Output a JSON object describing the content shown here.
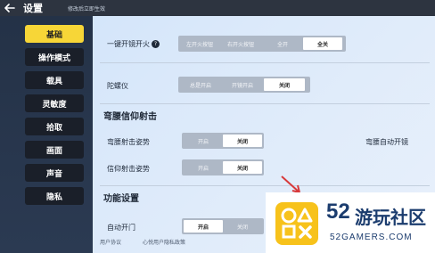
{
  "header": {
    "title": "设置",
    "hint": "修改后立即生效"
  },
  "sidebar": {
    "items": [
      {
        "label": "基础",
        "active": true
      },
      {
        "label": "操作模式"
      },
      {
        "label": "载具"
      },
      {
        "label": "灵敏度"
      },
      {
        "label": "拾取"
      },
      {
        "label": "画面"
      },
      {
        "label": "声音"
      },
      {
        "label": "隐私"
      }
    ]
  },
  "settings": {
    "one_key_fire": {
      "label": "一键开镜开火",
      "options": [
        "左开火按钮",
        "右开火按钮",
        "全开",
        "全关"
      ],
      "selected": "全关"
    },
    "gyroscope": {
      "label": "陀螺仪",
      "options": [
        "总是开启",
        "开镜开启",
        "关闭"
      ],
      "selected": "关闭"
    },
    "hipfire_section": {
      "title": "弯腰信仰射击",
      "stance": {
        "label": "弯腰射击姿势",
        "options": [
          "开启",
          "关闭"
        ],
        "selected": "关闭"
      },
      "auto_scope": {
        "label": "弯腰自动开镜"
      },
      "faith": {
        "label": "信仰射击姿势",
        "options": [
          "开启",
          "关闭"
        ],
        "selected": "关闭"
      }
    },
    "function_section": {
      "title": "功能设置",
      "auto_door": {
        "label": "自动开门",
        "options": [
          "开启",
          "关闭"
        ],
        "selected": "开启"
      }
    }
  },
  "footer": {
    "links": [
      "用户协议",
      "心悦用户隐私政策"
    ]
  },
  "watermark": {
    "number": "52",
    "name": "游玩社区",
    "domain": "52GAMERS.COM"
  },
  "colors": {
    "accent": "#f7d637",
    "sidebar": "#1a1f29",
    "header": "#2d3440",
    "segment": "#aeb8c6"
  }
}
